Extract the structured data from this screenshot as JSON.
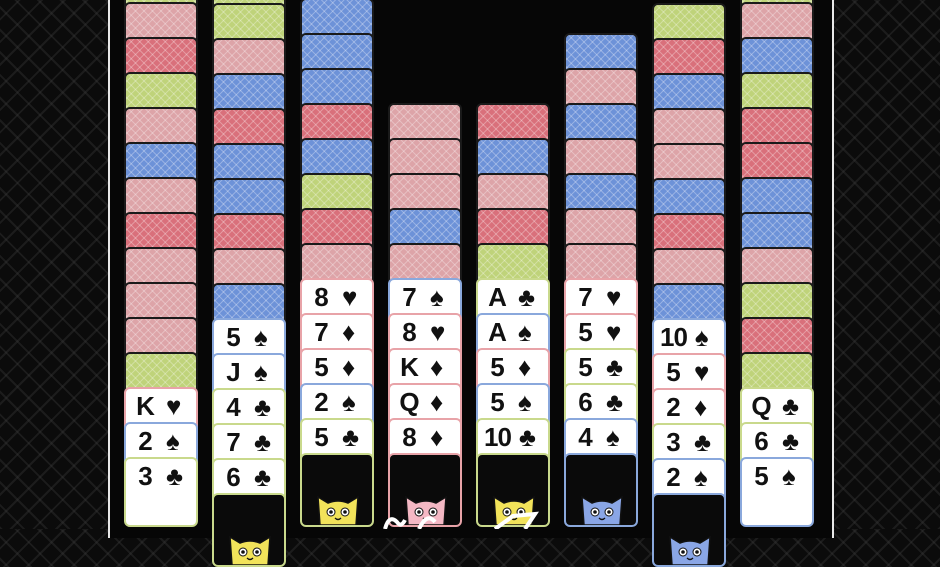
{
  "columns": [
    {
      "backs": [
        "red",
        "green",
        "pink",
        "red",
        "green",
        "pink",
        "blue",
        "pink",
        "red",
        "pink",
        "pink",
        "pink",
        "green"
      ],
      "faces": [
        {
          "rank": "K",
          "suit": "♥",
          "border": "pink"
        },
        {
          "rank": "2",
          "suit": "♠",
          "border": "blue"
        },
        {
          "rank": "3",
          "suit": "♣",
          "border": "green"
        }
      ],
      "cat": null
    },
    {
      "backs": [
        "green",
        "green",
        "pink",
        "blue",
        "red",
        "blue",
        "blue",
        "red",
        "pink",
        "blue"
      ],
      "faces": [
        {
          "rank": "5",
          "suit": "♠",
          "border": "blue"
        },
        {
          "rank": "J",
          "suit": "♠",
          "border": "blue"
        },
        {
          "rank": "4",
          "suit": "♣",
          "border": "green"
        },
        {
          "rank": "7",
          "suit": "♣",
          "border": "green"
        },
        {
          "rank": "6",
          "suit": "♣",
          "border": "green"
        }
      ],
      "cat": {
        "color": "yellow",
        "partial": true
      }
    },
    {
      "backs": [
        "blue",
        "blue",
        "blue",
        "red",
        "blue",
        "green",
        "red",
        "pink"
      ],
      "faces": [
        {
          "rank": "8",
          "suit": "♥",
          "border": "pink"
        },
        {
          "rank": "7",
          "suit": "♦",
          "border": "pink"
        },
        {
          "rank": "5",
          "suit": "♦",
          "border": "pink"
        },
        {
          "rank": "2",
          "suit": "♠",
          "border": "blue"
        },
        {
          "rank": "5",
          "suit": "♣",
          "border": "green"
        }
      ],
      "cat": {
        "color": "yellow",
        "partial": false
      }
    },
    {
      "backs": [
        "pink",
        "pink",
        "pink",
        "blue",
        "pink"
      ],
      "faces": [
        {
          "rank": "7",
          "suit": "♠",
          "border": "blue"
        },
        {
          "rank": "8",
          "suit": "♥",
          "border": "pink"
        },
        {
          "rank": "K",
          "suit": "♦",
          "border": "pink"
        },
        {
          "rank": "Q",
          "suit": "♦",
          "border": "pink"
        },
        {
          "rank": "8",
          "suit": "♦",
          "border": "pink"
        }
      ],
      "cat": {
        "color": "pink",
        "partial": false
      }
    },
    {
      "backs": [
        "red",
        "blue",
        "pink",
        "red",
        "green"
      ],
      "faces": [
        {
          "rank": "A",
          "suit": "♣",
          "border": "green"
        },
        {
          "rank": "A",
          "suit": "♠",
          "border": "blue"
        },
        {
          "rank": "5",
          "suit": "♦",
          "border": "pink"
        },
        {
          "rank": "5",
          "suit": "♠",
          "border": "blue"
        },
        {
          "rank": "10",
          "suit": "♣",
          "border": "green"
        }
      ],
      "cat": {
        "color": "yellow",
        "partial": false
      }
    },
    {
      "backs": [
        "blue",
        "pink",
        "blue",
        "pink",
        "blue",
        "pink",
        "pink"
      ],
      "faces": [
        {
          "rank": "7",
          "suit": "♥",
          "border": "pink"
        },
        {
          "rank": "5",
          "suit": "♥",
          "border": "pink"
        },
        {
          "rank": "5",
          "suit": "♣",
          "border": "green"
        },
        {
          "rank": "6",
          "suit": "♣",
          "border": "green"
        },
        {
          "rank": "4",
          "suit": "♠",
          "border": "blue"
        }
      ],
      "cat": {
        "color": "blue",
        "partial": false
      }
    },
    {
      "backs": [
        "green",
        "red",
        "blue",
        "pink",
        "pink",
        "blue",
        "red",
        "pink",
        "blue"
      ],
      "faces": [
        {
          "rank": "10",
          "suit": "♠",
          "border": "blue"
        },
        {
          "rank": "5",
          "suit": "♥",
          "border": "pink"
        },
        {
          "rank": "2",
          "suit": "♦",
          "border": "pink"
        },
        {
          "rank": "3",
          "suit": "♣",
          "border": "green"
        },
        {
          "rank": "2",
          "suit": "♠",
          "border": "blue"
        }
      ],
      "cat": {
        "color": "blue",
        "partial": true
      }
    },
    {
      "backs": [
        "green",
        "pink",
        "blue",
        "green",
        "red",
        "red",
        "blue",
        "blue",
        "pink",
        "green",
        "red",
        "green"
      ],
      "faces": [
        {
          "rank": "Q",
          "suit": "♣",
          "border": "green"
        },
        {
          "rank": "6",
          "suit": "♣",
          "border": "green"
        },
        {
          "rank": "5",
          "suit": "♠",
          "border": "blue"
        }
      ],
      "cat": null
    }
  ],
  "colors": {
    "back_red": "#d9707b",
    "back_pink": "#dda4a8",
    "back_blue": "#6d92d8",
    "back_green": "#bfd37a",
    "cat_yellow": "#f2e35a",
    "cat_pink": "#f4b8c4",
    "cat_blue": "#8aa6e6"
  }
}
